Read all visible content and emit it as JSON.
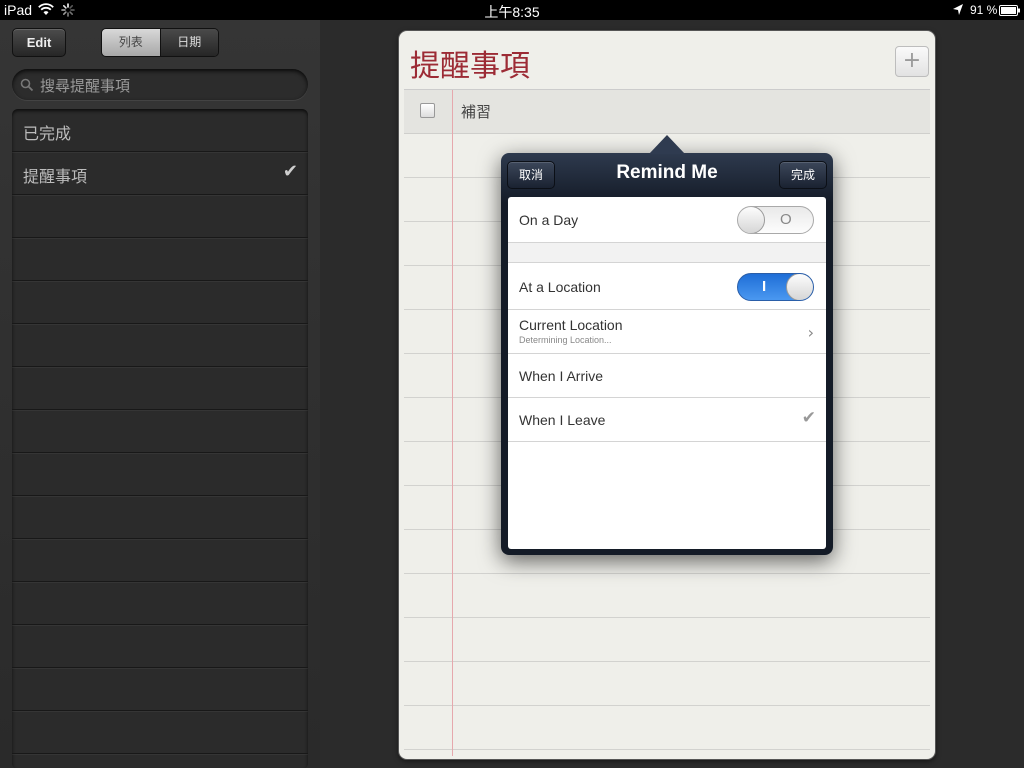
{
  "status_bar": {
    "carrier": "iPad",
    "time": "上午8:35",
    "battery_percent": "91 %"
  },
  "sidebar": {
    "edit_label": "Edit",
    "segments": [
      "列表",
      "日期"
    ],
    "search_placeholder": "搜尋提醒事項",
    "lists": [
      {
        "label": "已完成",
        "checked": false
      },
      {
        "label": "提醒事項",
        "checked": true
      }
    ],
    "checkmark": "✔"
  },
  "main": {
    "title": "提醒事項",
    "add_label": "+",
    "items": [
      {
        "text": "補習",
        "completed": false
      }
    ]
  },
  "popover": {
    "title": "Remind Me",
    "cancel_label": "取消",
    "done_label": "完成",
    "on_a_day": {
      "label": "On a Day",
      "toggle_text": "O",
      "on": false
    },
    "at_a_location": {
      "label": "At a Location",
      "toggle_text": "I",
      "on": true
    },
    "current_location": {
      "label": "Current Location",
      "sublabel": "Determining Location..."
    },
    "when_arrive": {
      "label": "When I Arrive",
      "selected": false
    },
    "when_leave": {
      "label": "When I Leave",
      "selected": true
    },
    "chevron": "›",
    "check": "✔"
  },
  "colors": {
    "title_red": "#9c2b35",
    "toggle_blue": "#2f80e6"
  }
}
